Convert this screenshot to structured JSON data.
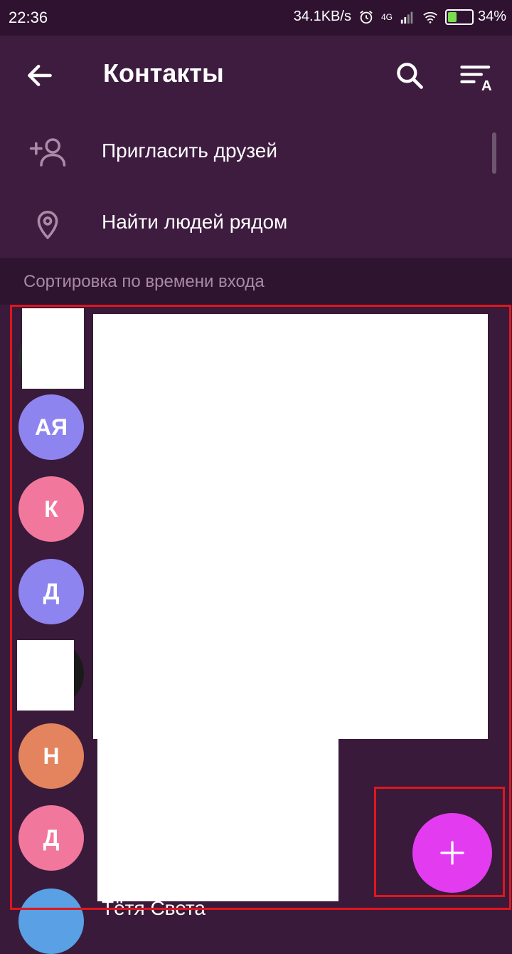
{
  "status_bar": {
    "time": "22:36",
    "network_speed": "34.1KB/s",
    "network_type": "4G",
    "battery": "34%"
  },
  "appbar": {
    "title": "Контакты",
    "icons": [
      "back-arrow-icon",
      "search-icon",
      "sort-alpha-icon"
    ]
  },
  "menu": {
    "items": [
      {
        "label": "Пригласить друзей",
        "icon": "add-person-icon"
      },
      {
        "label": "Найти людей рядом",
        "icon": "location-pin-icon"
      }
    ]
  },
  "section": {
    "header": "Сортировка по времени входа"
  },
  "contacts": [
    {
      "initials": "",
      "color": "#2c2c2c"
    },
    {
      "initials": "АЯ",
      "color": "#8e84ef"
    },
    {
      "initials": "К",
      "color": "#f1789c"
    },
    {
      "initials": "Д",
      "color": "#8e84ef"
    },
    {
      "initials": "",
      "color": "#1a1a1a"
    },
    {
      "initials": "Н",
      "color": "#e4845e"
    },
    {
      "initials": "Д",
      "color": "#f1789c"
    },
    {
      "initials": "",
      "color": "#5aa0e4"
    }
  ],
  "partial_contact_name": "Тётя Света",
  "fab": {
    "icon": "plus-icon",
    "color": "#e33cf0"
  },
  "colors": {
    "background": "#3a1a3a",
    "appbar": "#3e1c40",
    "highlight_outline": "#e0161c"
  }
}
